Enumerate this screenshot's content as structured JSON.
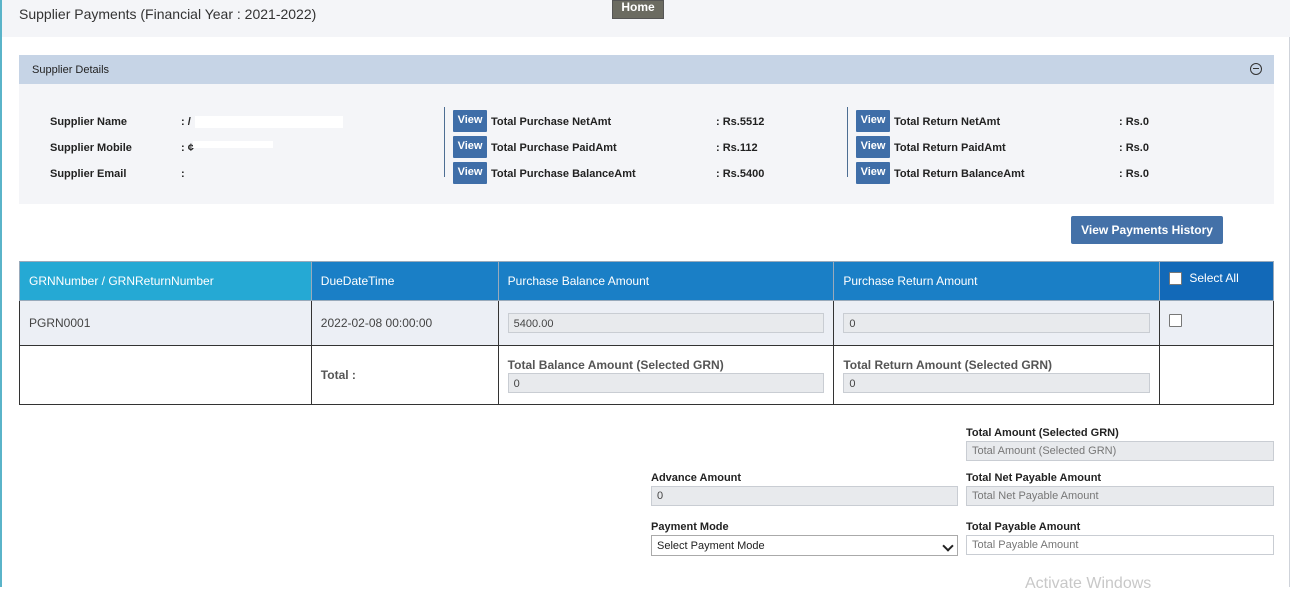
{
  "page_title": "Supplier Payments (Financial Year : 2021-2022)",
  "home_label": "Home",
  "supplier_details": {
    "title": "Supplier Details",
    "name_label": "Supplier Name",
    "name_value": ": /",
    "mobile_label": "Supplier Mobile",
    "mobile_value": ": ¢",
    "email_label": "Supplier Email",
    "email_value": ":",
    "view_label": "View",
    "purchase": [
      {
        "label": "Total Purchase NetAmt",
        "value": ": Rs.5512"
      },
      {
        "label": "Total Purchase PaidAmt",
        "value": ": Rs.112"
      },
      {
        "label": "Total Purchase BalanceAmt",
        "value": ": Rs.5400"
      }
    ],
    "returns": [
      {
        "label": "Total Return NetAmt",
        "value": ": Rs.0"
      },
      {
        "label": "Total Return PaidAmt",
        "value": ": Rs.0"
      },
      {
        "label": "Total Return BalanceAmt",
        "value": ": Rs.0"
      }
    ]
  },
  "history_button": "View Payments History",
  "table": {
    "headers": [
      "GRNNumber / GRNReturnNumber",
      "DueDateTime",
      "Purchase Balance Amount",
      "Purchase Return Amount"
    ],
    "select_all": "Select All",
    "rows": [
      {
        "grn": "PGRN0001",
        "due": "2022-02-08 00:00:00",
        "balance": "5400.00",
        "return_amt": "0"
      }
    ],
    "total_label": "Total :",
    "total_balance_label": "Total Balance Amount (Selected GRN)",
    "total_balance_value": "0",
    "total_return_label": "Total Return Amount (Selected GRN)",
    "total_return_value": "0"
  },
  "form": {
    "total_amount_label": "Total Amount (Selected GRN)",
    "total_amount_placeholder": "Total Amount (Selected GRN)",
    "advance_label": "Advance Amount",
    "advance_value": "0",
    "net_payable_label": "Total Net Payable Amount",
    "net_payable_placeholder": "Total Net Payable Amount",
    "payment_mode_label": "Payment Mode",
    "payment_mode_selected": "Select Payment Mode",
    "payable_label": "Total Payable Amount",
    "payable_placeholder": "Total Payable Amount"
  },
  "watermark": "Activate Windows",
  "colors": {
    "accent": "#3f6ea8",
    "header_teal": "#25a9d4",
    "header_blue": "#1a7fc6"
  }
}
